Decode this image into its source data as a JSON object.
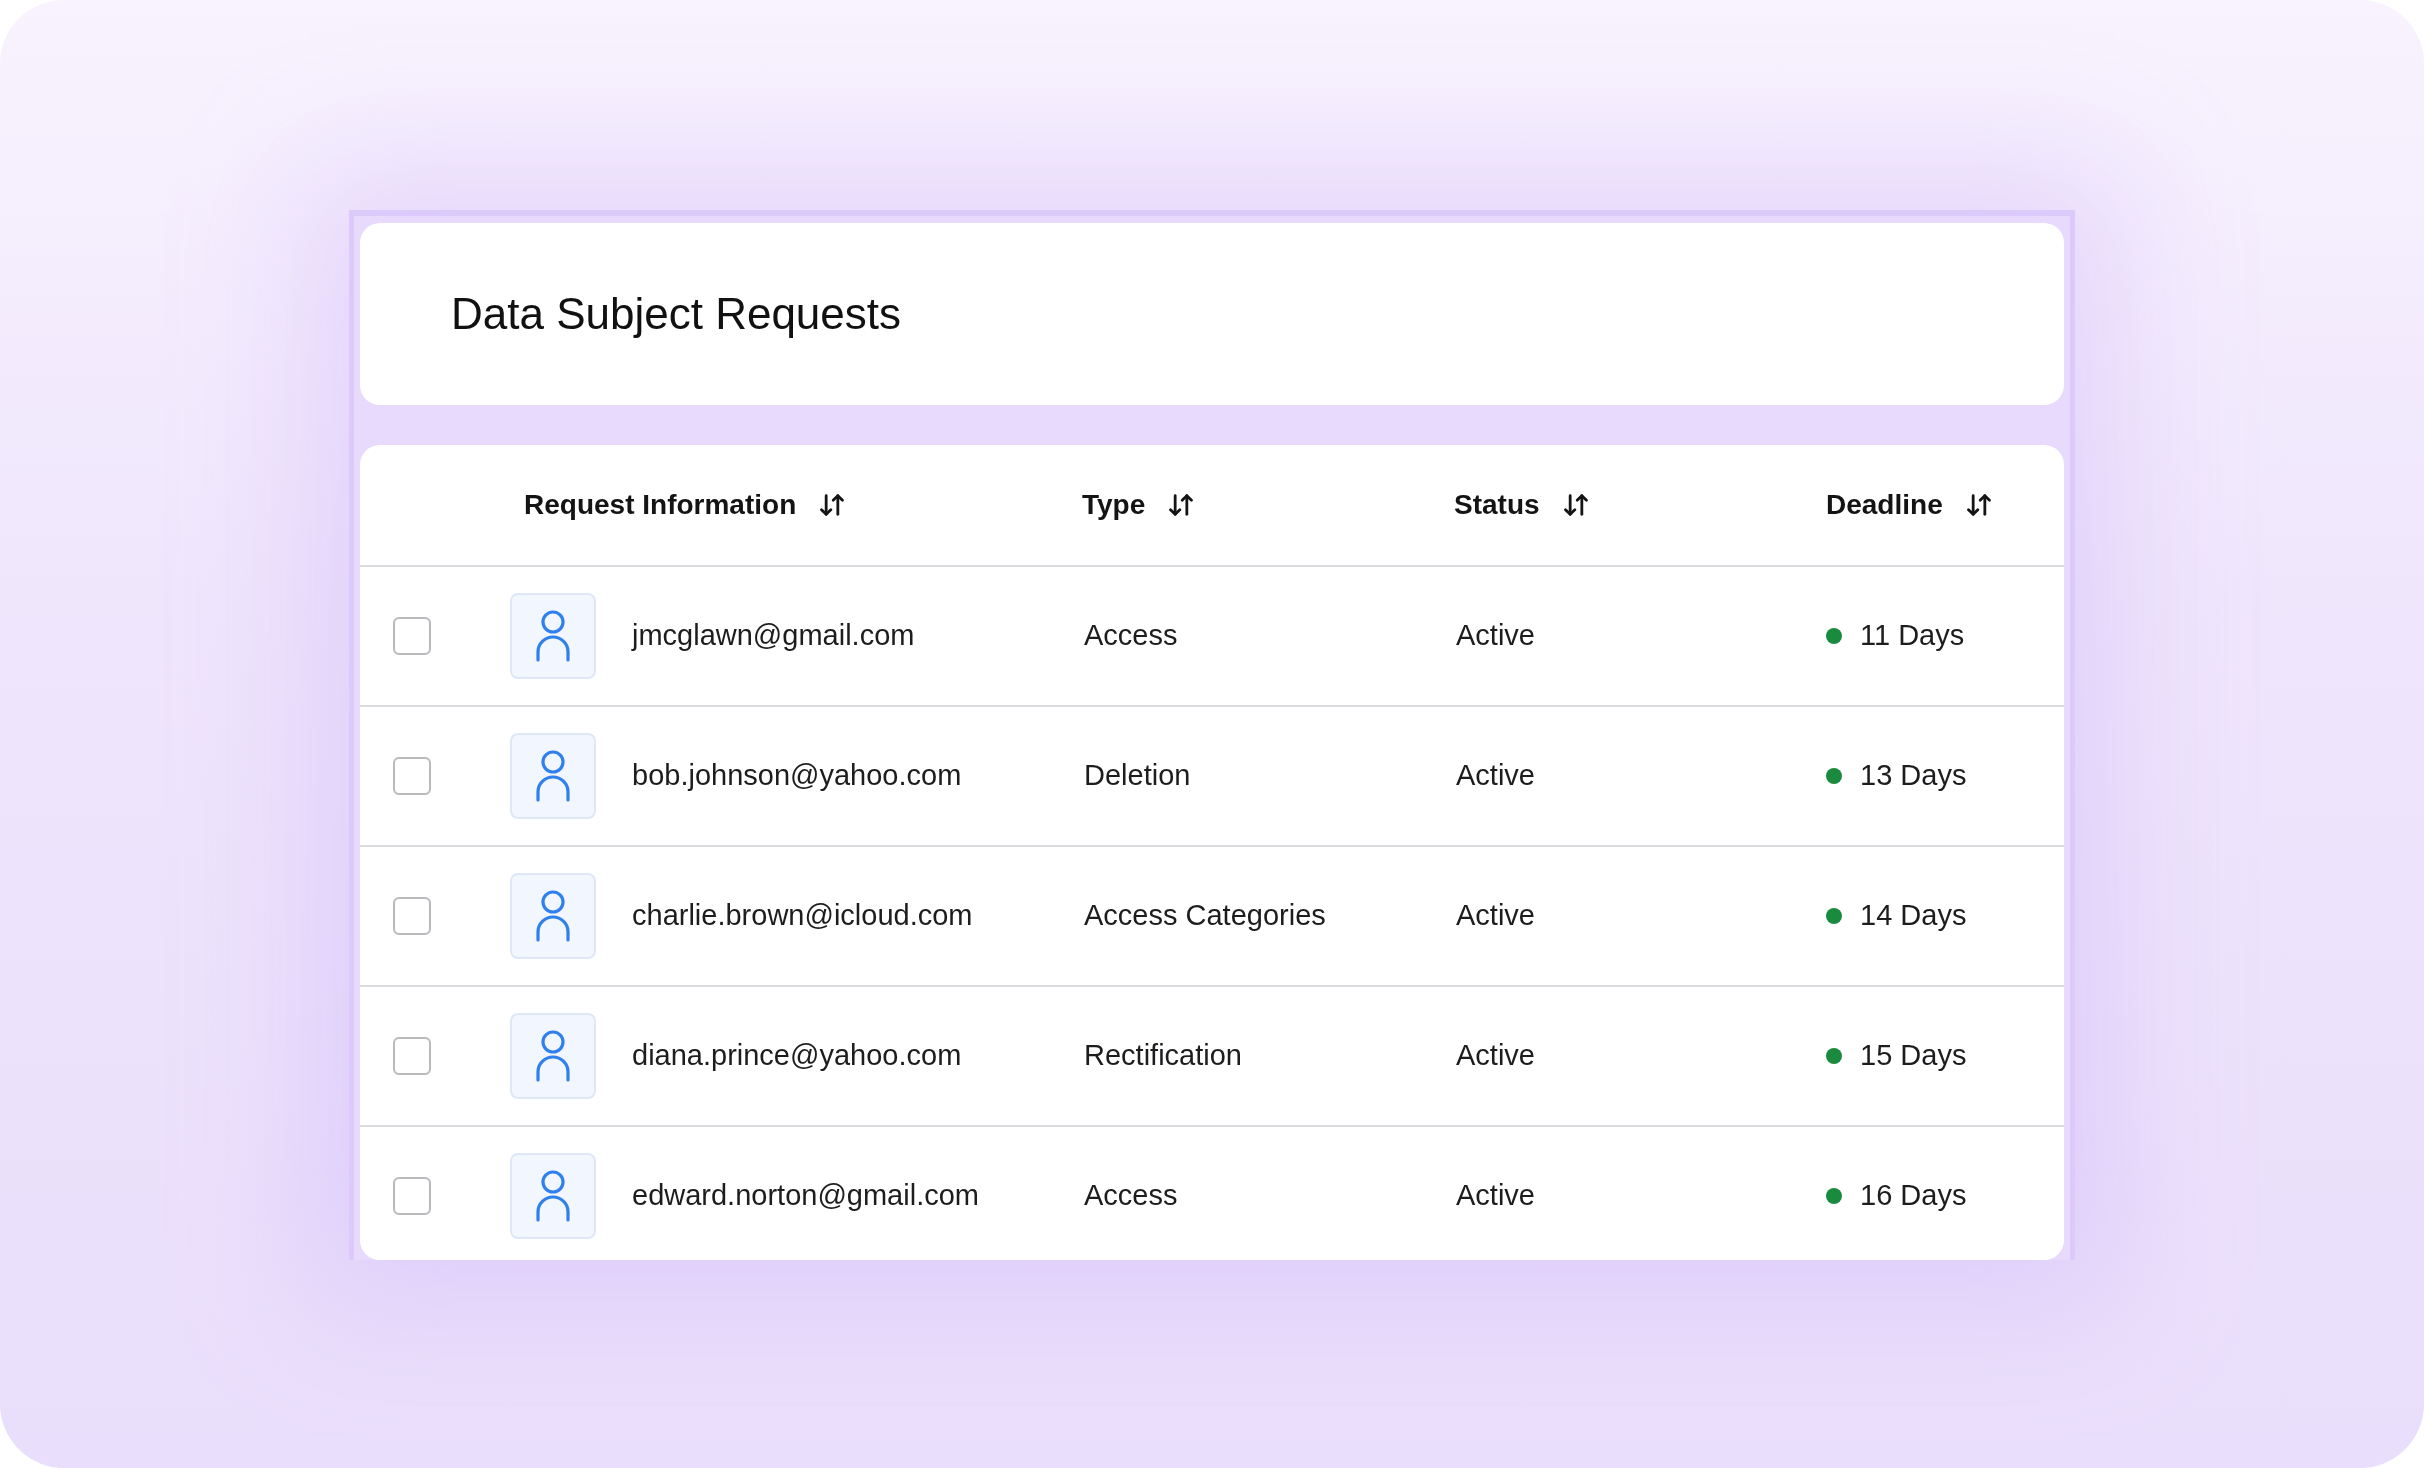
{
  "title": "Data Subject Requests",
  "table": {
    "columns": [
      {
        "label": "Request Information",
        "sortable": true
      },
      {
        "label": "Type",
        "sortable": true
      },
      {
        "label": "Status",
        "sortable": true
      },
      {
        "label": "Deadline",
        "sortable": true
      }
    ],
    "rows": [
      {
        "checked": false,
        "email": "jmcglawn@gmail.com",
        "type": "Access",
        "status": "Active",
        "deadline": "11 Days",
        "color": "#1a8a3e"
      },
      {
        "checked": false,
        "email": "bob.johnson@yahoo.com",
        "type": "Deletion",
        "status": "Active",
        "deadline": "13 Days",
        "color": "#1a8a3e"
      },
      {
        "checked": false,
        "email": "charlie.brown@icloud.com",
        "type": "Access Categories",
        "status": "Active",
        "deadline": "14 Days",
        "color": "#1a8a3e"
      },
      {
        "checked": false,
        "email": "diana.prince@yahoo.com",
        "type": "Rectification",
        "status": "Active",
        "deadline": "15 Days",
        "color": "#1a8a3e"
      },
      {
        "checked": false,
        "email": "edward.norton@gmail.com",
        "type": "Access",
        "status": "Active",
        "deadline": "16 Days",
        "color": "#1a8a3e"
      }
    ]
  }
}
